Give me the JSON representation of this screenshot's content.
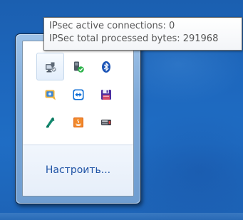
{
  "tooltip": {
    "lines": [
      "IPsec active connections: 0",
      "IPSec total processed bytes: 291968"
    ]
  },
  "tray": {
    "icons": [
      {
        "name": "network-security-icon",
        "hovered": true
      },
      {
        "name": "device-ready-check-icon",
        "hovered": false
      },
      {
        "name": "bluetooth-icon",
        "hovered": false
      },
      {
        "name": "messenger-icon",
        "hovered": false
      },
      {
        "name": "teamviewer-icon",
        "hovered": false
      },
      {
        "name": "save-floppy-icon",
        "hovered": false
      },
      {
        "name": "phone-icon",
        "hovered": false
      },
      {
        "name": "java-icon",
        "hovered": false
      },
      {
        "name": "usb-device-icon",
        "hovered": false
      }
    ],
    "customize_label": "Настроить..."
  },
  "colors": {
    "desktop": "#1d67bd",
    "link": "#1f53a5",
    "bluetooth": "#1d55b7",
    "green_check": "#2db34a",
    "java": "#e46c1b"
  }
}
